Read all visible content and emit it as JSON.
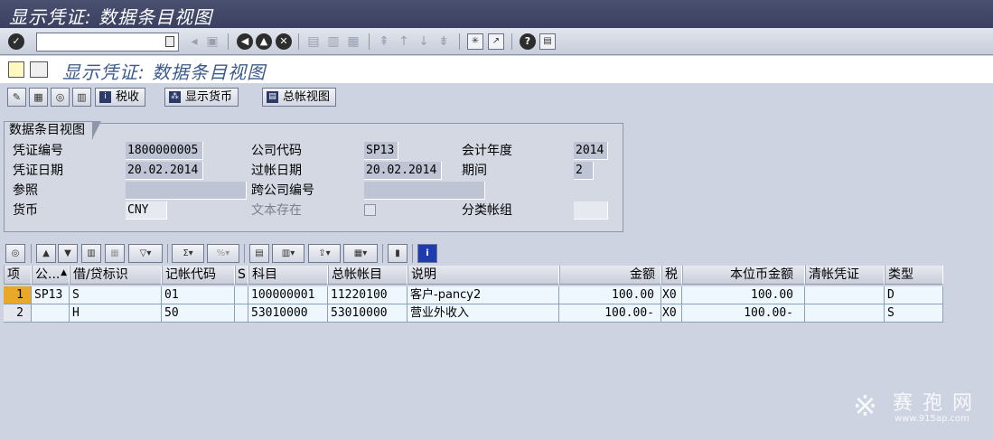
{
  "window": {
    "title": "显示凭证: 数据条目视图"
  },
  "std_toolbar": {
    "command_field": "",
    "icons": [
      "enter-icon",
      "save-icon",
      "back-icon",
      "exit-icon",
      "cancel-icon",
      "print-icon",
      "find-icon",
      "find-next-icon",
      "first-page-icon",
      "prev-page-icon",
      "next-page-icon",
      "last-page-icon",
      "new-session-icon",
      "shortcut-icon",
      "help-icon",
      "layout-icon"
    ]
  },
  "screen": {
    "title": "显示凭证: 数据条目视图"
  },
  "app_toolbar": {
    "tax_button": "税收",
    "currency_button": "显示货币",
    "gl_view_button": "总帐视图"
  },
  "header": {
    "group_title": "数据条目视图",
    "doc_no_label": "凭证编号",
    "doc_no": "1800000005",
    "company_label": "公司代码",
    "company": "SP13",
    "fiscal_year_label": "会计年度",
    "fiscal_year": "2014",
    "doc_date_label": "凭证日期",
    "doc_date": "20.02.2014",
    "posting_date_label": "过帐日期",
    "posting_date": "20.02.2014",
    "period_label": "期间",
    "period": "2",
    "reference_label": "参照",
    "reference": "",
    "cross_cc_label": "跨公司编号",
    "cross_cc": "",
    "currency_label": "货币",
    "currency": "CNY",
    "text_exists_label": "文本存在",
    "ledger_group_label": "分类帐组",
    "ledger_group": ""
  },
  "grid": {
    "columns": [
      "项",
      "公...",
      "借/贷标识",
      "记帐代码",
      "S",
      "科目",
      "总帐帐目",
      "说明",
      "金额",
      "税",
      "本位币金额",
      "清帐凭证",
      "类型"
    ],
    "rows": [
      {
        "item": "1",
        "company": "SP13",
        "dc": "S",
        "pk": "01",
        "s": "",
        "account": "100000001",
        "gl": "11220100",
        "text": "客户-pancy2",
        "amount": "100.00",
        "tax": "X0",
        "local_amount": "100.00",
        "clearing": "",
        "type": "D"
      },
      {
        "item": "2",
        "company": "",
        "dc": "H",
        "pk": "50",
        "s": "",
        "account": "53010000",
        "gl": "53010000",
        "text": "营业外收入",
        "amount": "100.00-",
        "tax": "X0",
        "local_amount": "100.00-",
        "clearing": "",
        "type": "S"
      }
    ]
  },
  "watermark": {
    "brand": "赛 孢 网",
    "url": "www.915ap.com"
  }
}
